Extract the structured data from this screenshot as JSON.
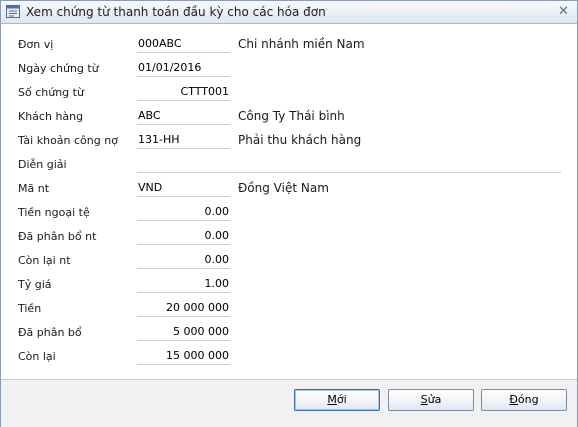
{
  "window": {
    "title": "Xem chứng từ thanh toán đầu kỳ cho các hóa đơn",
    "close_glyph": "✕"
  },
  "form": {
    "don_vi": {
      "label": "Đơn vị",
      "value": "000ABC",
      "desc": "Chi nhánh miền Nam"
    },
    "ngay_chung_tu": {
      "label": "Ngày chứng từ",
      "value": "01/01/2016"
    },
    "so_chung_tu": {
      "label": "Số chứng từ",
      "value": "CTTT001"
    },
    "khach_hang": {
      "label": "Khách hàng",
      "value": "ABC",
      "desc": "Công Ty Thái bình"
    },
    "tai_khoan_cong_no": {
      "label": "Tài khoản công nợ",
      "value": "131-HH",
      "desc": "Phải thu khách hàng"
    },
    "dien_giai": {
      "label": "Diễn giải",
      "value": ""
    },
    "ma_nt": {
      "label": "Mã nt",
      "value": "VND",
      "desc": "Đồng Việt Nam"
    },
    "tien_ngoai_te": {
      "label": "Tiền ngoại tệ",
      "value": "0.00"
    },
    "da_phan_bo_nt": {
      "label": "Đã phân bổ nt",
      "value": "0.00"
    },
    "con_lai_nt": {
      "label": "Còn lại nt",
      "value": "0.00"
    },
    "ty_gia": {
      "label": "Tỷ giá",
      "value": "1.00"
    },
    "tien": {
      "label": "Tiền",
      "value": "20 000 000"
    },
    "da_phan_bo": {
      "label": "Đã phân bổ",
      "value": "5 000 000"
    },
    "con_lai": {
      "label": "Còn lại",
      "value": "15 000 000"
    }
  },
  "buttons": {
    "new": {
      "hotkey": "M",
      "rest": "ới"
    },
    "edit": {
      "hotkey": "S",
      "rest": "ửa"
    },
    "close": {
      "hotkey": "Đ",
      "rest": "óng"
    }
  }
}
